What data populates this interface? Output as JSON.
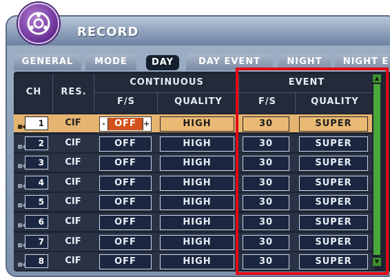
{
  "window": {
    "title": "RECORD"
  },
  "tabs": [
    {
      "label": "GENERAL"
    },
    {
      "label": "MODE"
    },
    {
      "label": "DAY"
    },
    {
      "label": "DAY EVENT"
    },
    {
      "label": "NIGHT"
    },
    {
      "label": "NIGHT E"
    }
  ],
  "table": {
    "headers": {
      "ch": "CH",
      "res": "RES.",
      "continuous": "CONTINUOUS",
      "event": "EVENT",
      "fs": "F/S",
      "quality": "QUALITY"
    },
    "rows": [
      {
        "ch": "1",
        "res": "CIF",
        "cont_fs": "OFF",
        "cont_quality": "HIGH",
        "event_fs": "30",
        "event_quality": "SUPER",
        "selected": true
      },
      {
        "ch": "2",
        "res": "CIF",
        "cont_fs": "OFF",
        "cont_quality": "HIGH",
        "event_fs": "30",
        "event_quality": "SUPER"
      },
      {
        "ch": "3",
        "res": "CIF",
        "cont_fs": "OFF",
        "cont_quality": "HIGH",
        "event_fs": "30",
        "event_quality": "SUPER"
      },
      {
        "ch": "4",
        "res": "CIF",
        "cont_fs": "OFF",
        "cont_quality": "HIGH",
        "event_fs": "30",
        "event_quality": "SUPER"
      },
      {
        "ch": "5",
        "res": "CIF",
        "cont_fs": "OFF",
        "cont_quality": "HIGH",
        "event_fs": "30",
        "event_quality": "SUPER"
      },
      {
        "ch": "6",
        "res": "CIF",
        "cont_fs": "OFF",
        "cont_quality": "HIGH",
        "event_fs": "30",
        "event_quality": "SUPER"
      },
      {
        "ch": "7",
        "res": "CIF",
        "cont_fs": "OFF",
        "cont_quality": "HIGH",
        "event_fs": "30",
        "event_quality": "SUPER"
      },
      {
        "ch": "8",
        "res": "CIF",
        "cont_fs": "OFF",
        "cont_quality": "HIGH",
        "event_fs": "30",
        "event_quality": "SUPER"
      }
    ],
    "stepper": {
      "minus": "-",
      "plus": "+"
    }
  },
  "colors": {
    "highlight": "#e30613",
    "selected_row": "#e4b470",
    "panel": "#1d2330",
    "scroll_thumb": "#49a83a"
  }
}
